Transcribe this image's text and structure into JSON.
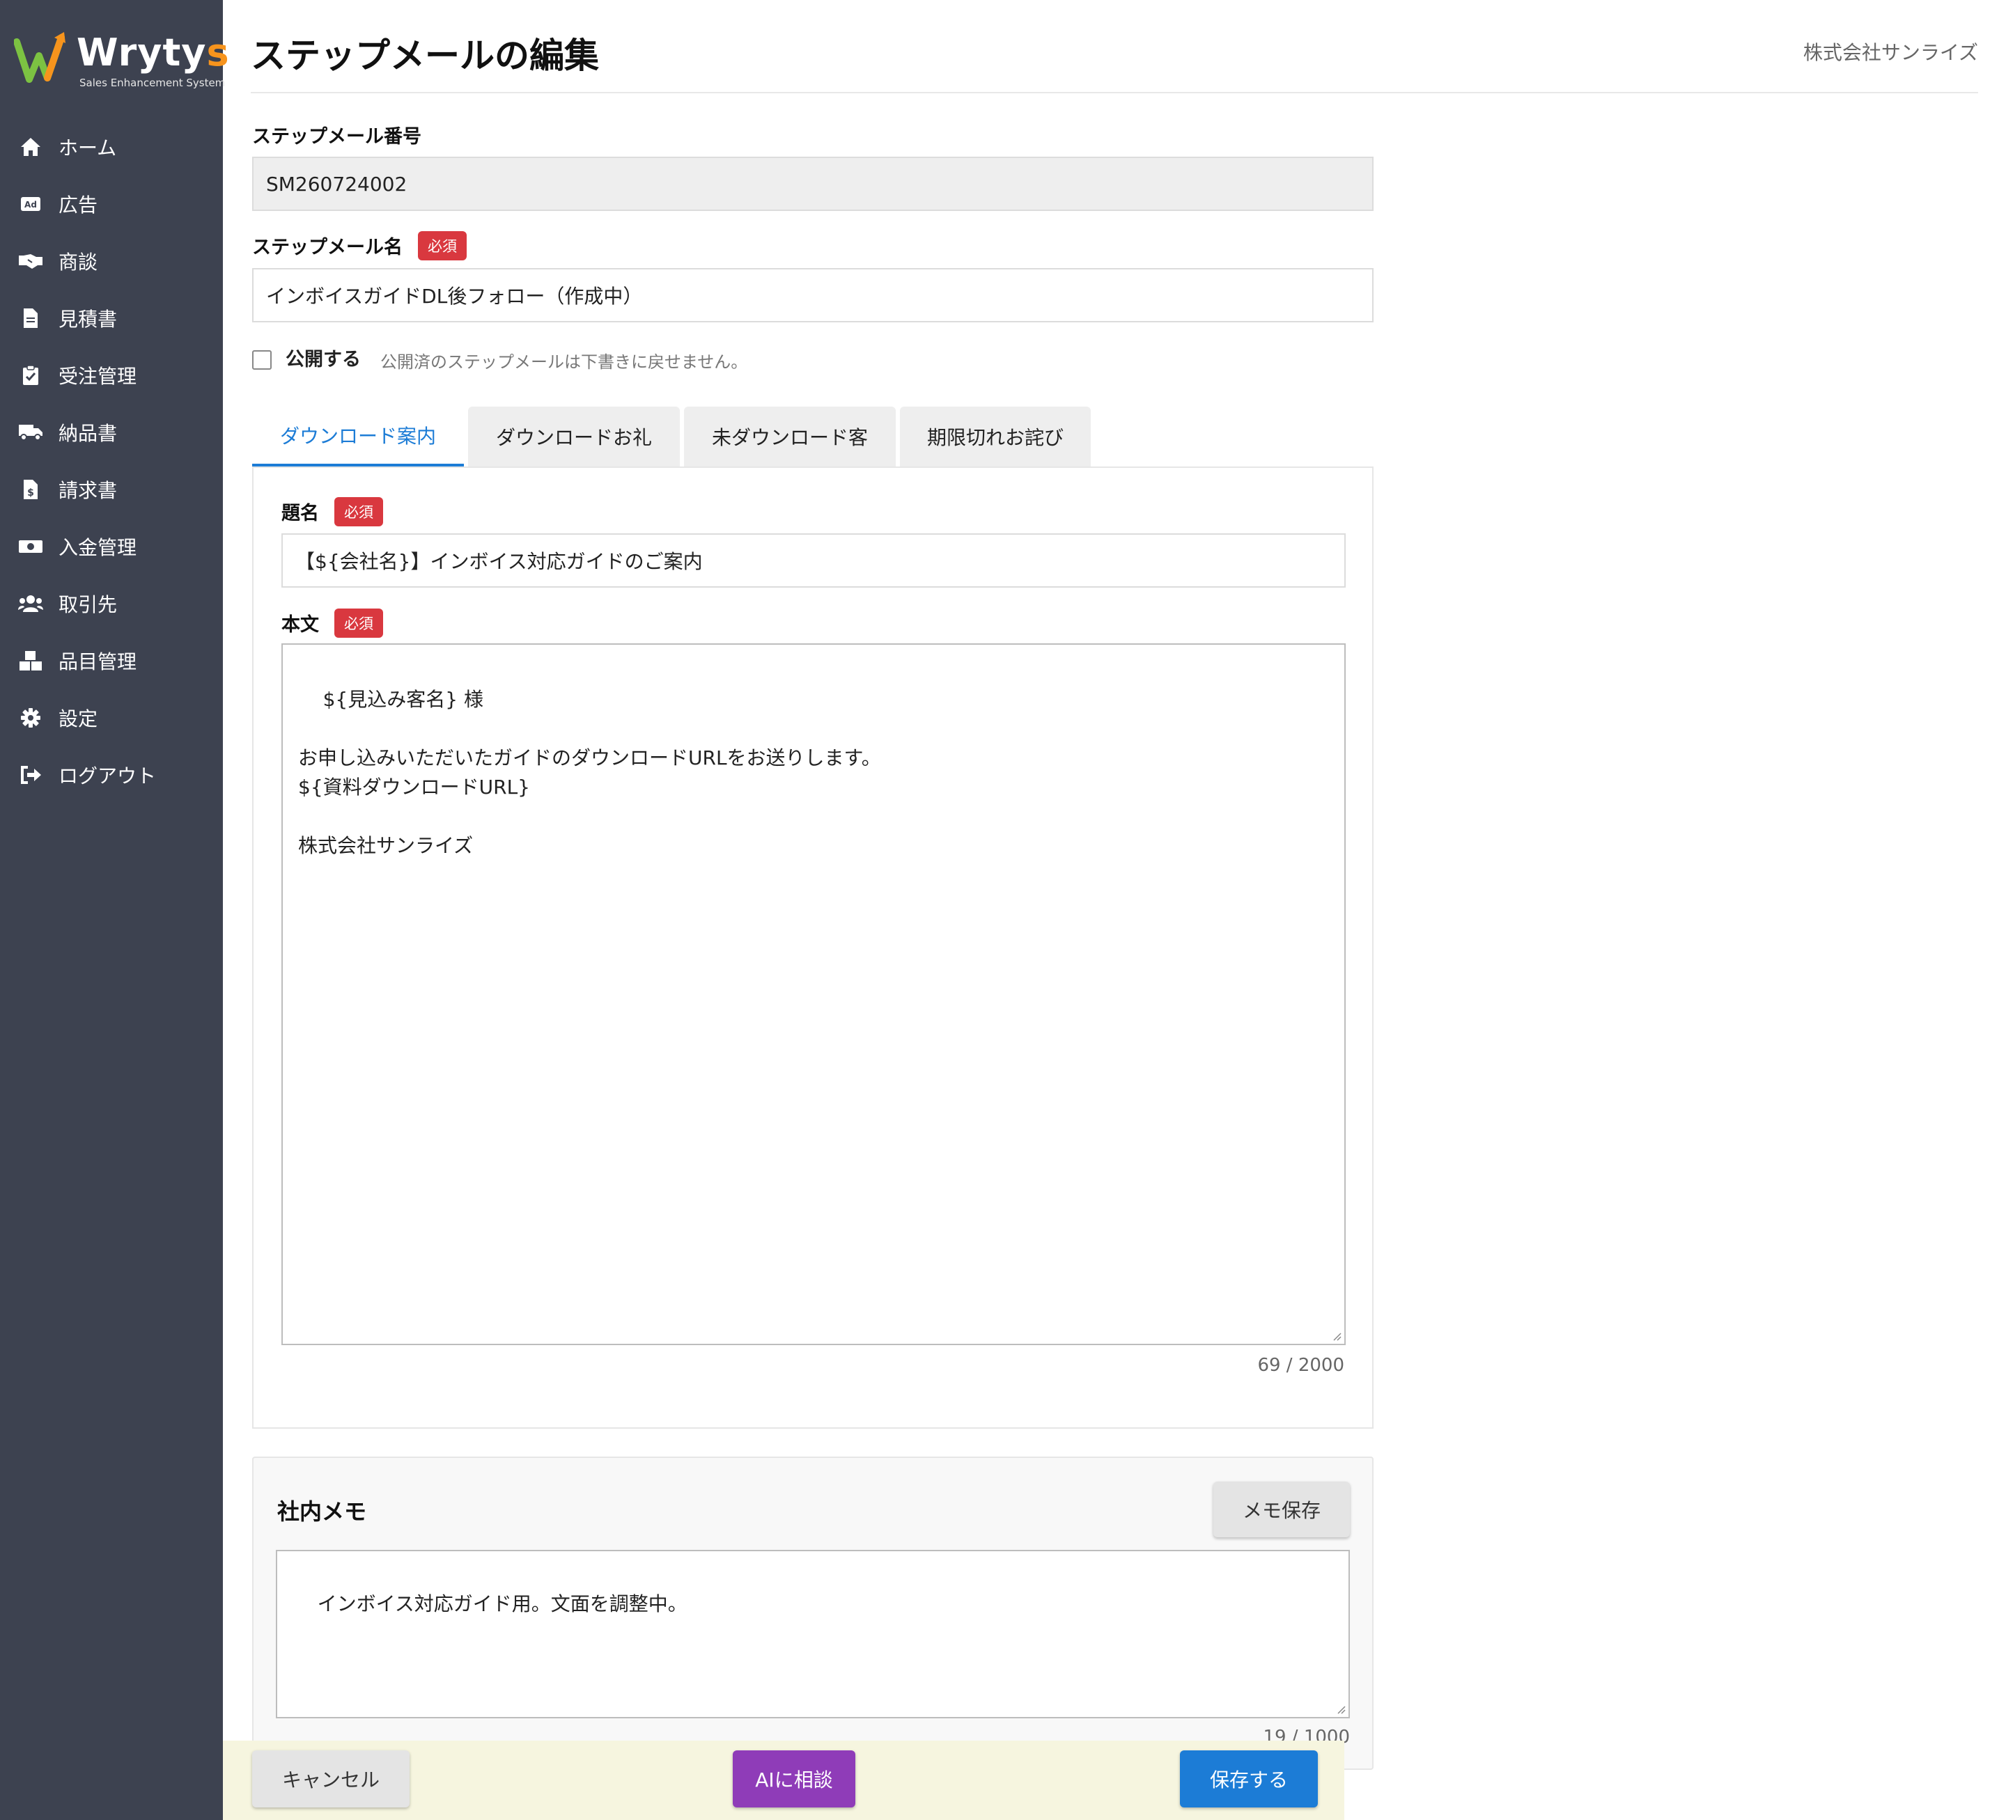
{
  "app": {
    "logo_text_main": "Wryty",
    "logo_text_accent": "s",
    "logo_subtitle": "Sales Enhancement System",
    "brand_color": "#f7941d",
    "sidebar_color": "#3d4250"
  },
  "sidebar": {
    "items": [
      {
        "label": "ホーム",
        "icon": "home-icon"
      },
      {
        "label": "広告",
        "icon": "ad-icon"
      },
      {
        "label": "商談",
        "icon": "handshake-icon"
      },
      {
        "label": "見積書",
        "icon": "document-icon"
      },
      {
        "label": "受注管理",
        "icon": "clipboard-check-icon"
      },
      {
        "label": "納品書",
        "icon": "truck-icon"
      },
      {
        "label": "請求書",
        "icon": "invoice-icon"
      },
      {
        "label": "入金管理",
        "icon": "money-icon"
      },
      {
        "label": "取引先",
        "icon": "users-icon"
      },
      {
        "label": "品目管理",
        "icon": "boxes-icon"
      },
      {
        "label": "設定",
        "icon": "gear-icon"
      },
      {
        "label": "ログアウト",
        "icon": "logout-icon"
      }
    ]
  },
  "header": {
    "title": "ステップメールの編集",
    "company": "株式会社サンライズ"
  },
  "form": {
    "number_label": "ステップメール番号",
    "number_value": "SM260724002",
    "name_label": "ステップメール名",
    "required_badge": "必須",
    "name_value": "インボイスガイドDL後フォロー（作成中）",
    "publish_label": "公開する",
    "publish_checked": false,
    "publish_note": "公開済のステップメールは下書きに戻せません。"
  },
  "tabs": [
    {
      "label": "ダウンロード案内",
      "active": true
    },
    {
      "label": "ダウンロードお礼",
      "active": false
    },
    {
      "label": "未ダウンロード客",
      "active": false
    },
    {
      "label": "期限切れお詫び",
      "active": false
    }
  ],
  "mail": {
    "subject_label": "題名",
    "subject_value": "【${会社名}】インボイス対応ガイドのご案内",
    "body_label": "本文",
    "body_value": "${見込み客名} 様\n\nお申し込みいただいたガイドのダウンロードURLをお送りします。\n${資料ダウンロードURL}\n\n株式会社サンライズ",
    "body_counter": "69 / 2000"
  },
  "memo": {
    "title": "社内メモ",
    "save_label": "メモ保存",
    "value": "インボイス対応ガイド用。文面を調整中。",
    "counter": "19 / 1000"
  },
  "footer": {
    "cancel_label": "キャンセル",
    "ai_label": "AIに相談",
    "save_label": "保存する"
  }
}
